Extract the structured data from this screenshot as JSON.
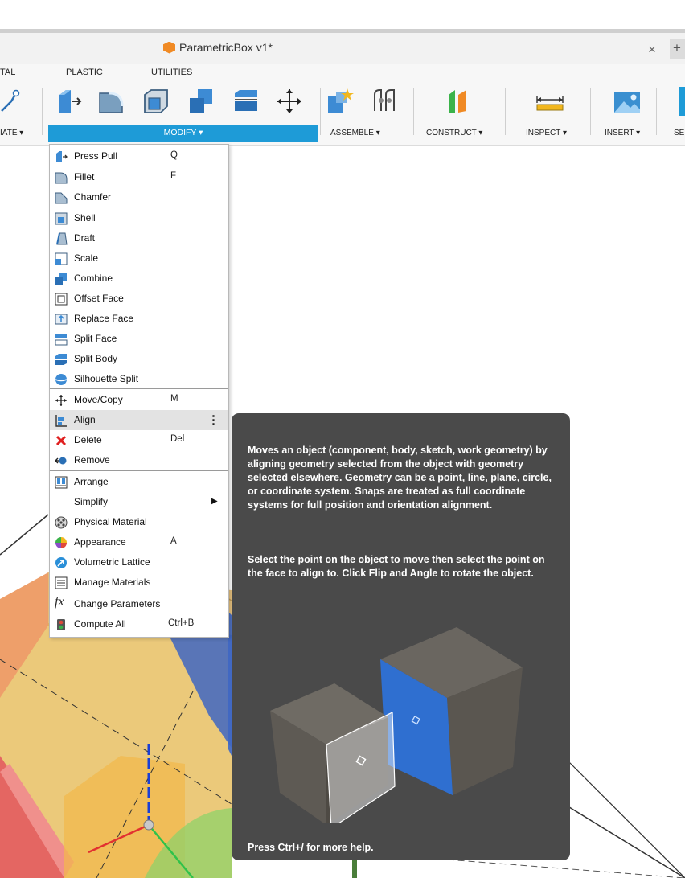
{
  "window": {
    "title": "ParametricBox v1*",
    "close_glyph": "×",
    "new_tab_glyph": "+"
  },
  "ribbon": {
    "tabs": [
      {
        "label": "TAL"
      },
      {
        "label": "PLASTIC"
      },
      {
        "label": "UTILITIES"
      }
    ],
    "groups": {
      "create": "IATE ▾",
      "modify": "MODIFY ▾",
      "assemble": "ASSEMBLE ▾",
      "construct": "CONSTRUCT ▾",
      "inspect": "INSPECT ▾",
      "insert": "INSERT ▾",
      "select": "SE"
    },
    "modify_tools": [
      "press-pull-icon",
      "fillet-icon",
      "shell-icon",
      "combine-icon",
      "split-face-icon",
      "move-icon"
    ],
    "accent_color": "#1e9bd7"
  },
  "menu": {
    "items": [
      {
        "label": "Press Pull",
        "shortcut": "Q",
        "icon": "press-pull-icon"
      },
      {
        "label": "Fillet",
        "shortcut": "F",
        "icon": "fillet-icon"
      },
      {
        "label": "Chamfer",
        "shortcut": "",
        "icon": "chamfer-icon"
      },
      {
        "label": "Shell",
        "shortcut": "",
        "icon": "shell-icon"
      },
      {
        "label": "Draft",
        "shortcut": "",
        "icon": "draft-icon"
      },
      {
        "label": "Scale",
        "shortcut": "",
        "icon": "scale-icon"
      },
      {
        "label": "Combine",
        "shortcut": "",
        "icon": "combine-icon"
      },
      {
        "label": "Offset Face",
        "shortcut": "",
        "icon": "offset-face-icon"
      },
      {
        "label": "Replace Face",
        "shortcut": "",
        "icon": "replace-face-icon"
      },
      {
        "label": "Split Face",
        "shortcut": "",
        "icon": "split-face-icon"
      },
      {
        "label": "Split Body",
        "shortcut": "",
        "icon": "split-body-icon"
      },
      {
        "label": "Silhouette Split",
        "shortcut": "",
        "icon": "silhouette-split-icon"
      },
      {
        "label": "Move/Copy",
        "shortcut": "M",
        "icon": "move-copy-icon"
      },
      {
        "label": "Align",
        "shortcut": "",
        "icon": "align-icon"
      },
      {
        "label": "Delete",
        "shortcut": "Del",
        "icon": "delete-icon"
      },
      {
        "label": "Remove",
        "shortcut": "",
        "icon": "remove-icon"
      },
      {
        "label": "Arrange",
        "shortcut": "",
        "icon": "arrange-icon"
      },
      {
        "label": "Simplify",
        "shortcut": "",
        "icon": "submenu-arrow-icon"
      },
      {
        "label": "Physical Material",
        "shortcut": "",
        "icon": "physical-material-icon"
      },
      {
        "label": "Appearance",
        "shortcut": "A",
        "icon": "appearance-icon"
      },
      {
        "label": "Volumetric Lattice",
        "shortcut": "",
        "icon": "volumetric-lattice-icon"
      },
      {
        "label": "Manage Materials",
        "shortcut": "",
        "icon": "manage-materials-icon"
      },
      {
        "label": "Change Parameters",
        "shortcut": "",
        "icon": "fx-icon"
      },
      {
        "label": "Compute All",
        "shortcut": "Ctrl+B",
        "icon": "compute-all-icon"
      }
    ],
    "highlighted": "Align",
    "more_glyph": "⋮",
    "submenu_glyph": "▶",
    "fx_glyph": "fx"
  },
  "tooltip": {
    "description": "Moves an object (component, body, sketch, work geometry) by aligning geometry selected from the object with geometry selected elsewhere. Geometry can be a point, line, plane, circle, or coordinate system. Snaps are treated as full coordinate systems for full position and orientation alignment.",
    "instructions": "Select the point on the object to move then select the point on the face to align to. Click Flip and Angle to rotate the object.",
    "help": "Press Ctrl+/ for more help."
  }
}
